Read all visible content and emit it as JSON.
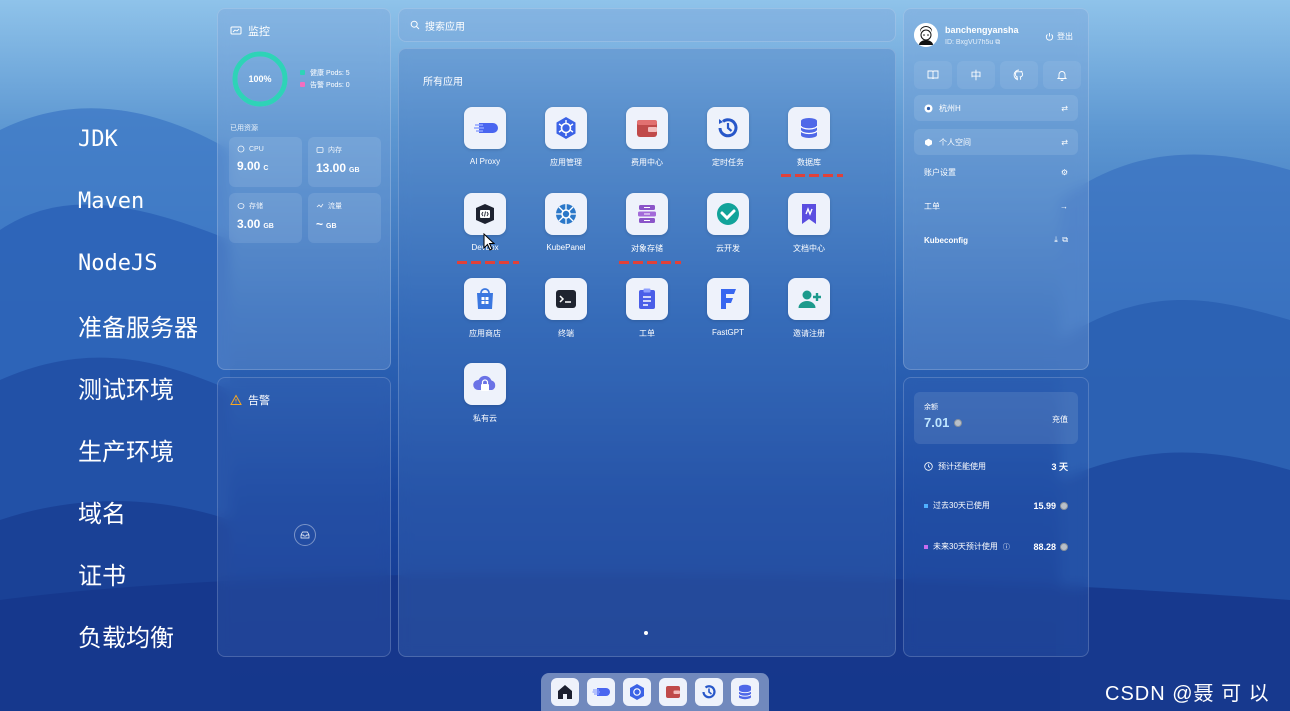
{
  "left_topics": [
    "JDK",
    "Maven",
    "NodeJS",
    "准备服务器",
    "测试环境",
    "生产环境",
    "域名",
    "证书",
    "负载均衡"
  ],
  "monitor": {
    "title": "监控",
    "health_percent": 100,
    "donut_label": "100%",
    "legend": [
      "健康 Pods: 5",
      "告警 Pods: 0"
    ],
    "resources_title": "已用资源",
    "cards": [
      {
        "label": "CPU",
        "value": "9.00",
        "unit": "C"
      },
      {
        "label": "内存",
        "value": "13.00",
        "unit": "GB"
      },
      {
        "label": "存储",
        "value": "3.00",
        "unit": "GB"
      },
      {
        "label": "流量",
        "value": "~",
        "unit": "GB"
      }
    ]
  },
  "alarm": {
    "title": "告警"
  },
  "search": {
    "placeholder": "搜索应用"
  },
  "apps": {
    "title": "所有应用",
    "items": [
      {
        "label": "AI Proxy",
        "icon": "ai-proxy-icon"
      },
      {
        "label": "应用管理",
        "icon": "app-manage-icon"
      },
      {
        "label": "费用中心",
        "icon": "wallet-icon"
      },
      {
        "label": "定时任务",
        "icon": "cron-icon"
      },
      {
        "label": "数据库",
        "icon": "database-icon"
      },
      {
        "label": "Devbox",
        "icon": "devbox-icon"
      },
      {
        "label": "KubePanel",
        "icon": "kubepanel-icon"
      },
      {
        "label": "对象存储",
        "icon": "object-storage-icon"
      },
      {
        "label": "云开发",
        "icon": "cloud-dev-icon"
      },
      {
        "label": "文档中心",
        "icon": "docs-icon"
      },
      {
        "label": "应用商店",
        "icon": "app-store-icon"
      },
      {
        "label": "终端",
        "icon": "terminal-icon"
      },
      {
        "label": "工单",
        "icon": "ticket-icon"
      },
      {
        "label": "FastGPT",
        "icon": "fastgpt-icon"
      },
      {
        "label": "邀请注册",
        "icon": "invite-icon"
      },
      {
        "label": "私有云",
        "icon": "private-cloud-icon"
      }
    ]
  },
  "user": {
    "name": "banchengyansha",
    "id": "ID: BxgVU7h5u",
    "logout": "登出",
    "lang_button": "中",
    "region": "杭州H",
    "workspace": "个人空间",
    "account_settings": "账户设置",
    "ticket": "工单",
    "kubeconfig": "Kubeconfig"
  },
  "billing": {
    "balance_label": "余额",
    "balance": "7.01",
    "recharge": "充值",
    "days_label": "预计还能使用",
    "days_value": "3 天",
    "past_label": "过去30天已使用",
    "past_value": "15.99",
    "future_label": "未来30天预计使用",
    "future_value": "88.28",
    "past_color": "#4fb0ff",
    "future_color": "#c66cf0"
  },
  "watermark": "CSDN @聂 可 以"
}
